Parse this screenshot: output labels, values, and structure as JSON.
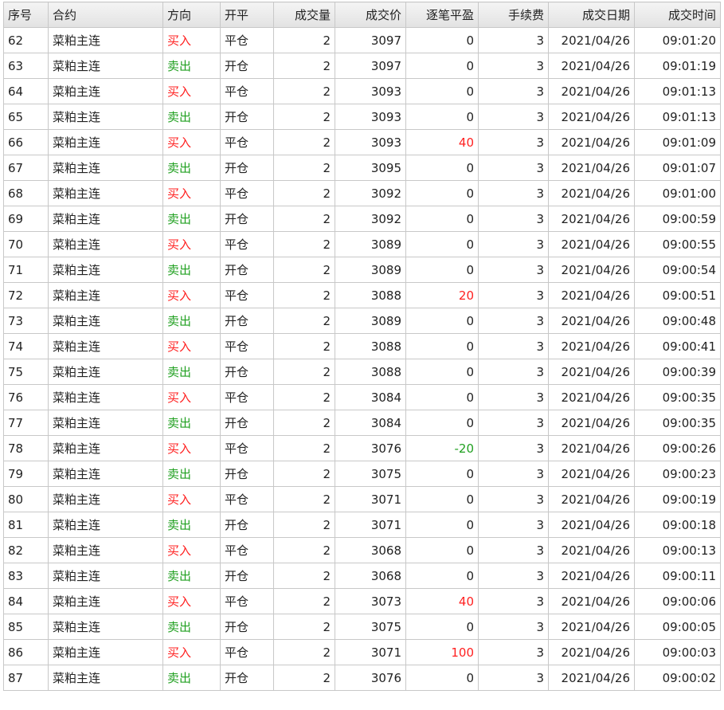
{
  "table": {
    "headers": [
      "序号",
      "合约",
      "方向",
      "开平",
      "成交量",
      "成交价",
      "逐笔平盈",
      "手续费",
      "成交日期",
      "成交时间"
    ],
    "colors": {
      "buy": "#ff2020",
      "sell": "#20a020",
      "profit": "#ff2020",
      "loss": "#20a020"
    },
    "rows": [
      [
        "62",
        "菜粕主连",
        "买入",
        "平仓",
        "2",
        "3097",
        "0",
        "3",
        "2021/04/26",
        "09:01:20"
      ],
      [
        "63",
        "菜粕主连",
        "卖出",
        "开仓",
        "2",
        "3097",
        "0",
        "3",
        "2021/04/26",
        "09:01:19"
      ],
      [
        "64",
        "菜粕主连",
        "买入",
        "平仓",
        "2",
        "3093",
        "0",
        "3",
        "2021/04/26",
        "09:01:13"
      ],
      [
        "65",
        "菜粕主连",
        "卖出",
        "开仓",
        "2",
        "3093",
        "0",
        "3",
        "2021/04/26",
        "09:01:13"
      ],
      [
        "66",
        "菜粕主连",
        "买入",
        "平仓",
        "2",
        "3093",
        "40",
        "3",
        "2021/04/26",
        "09:01:09"
      ],
      [
        "67",
        "菜粕主连",
        "卖出",
        "开仓",
        "2",
        "3095",
        "0",
        "3",
        "2021/04/26",
        "09:01:07"
      ],
      [
        "68",
        "菜粕主连",
        "买入",
        "平仓",
        "2",
        "3092",
        "0",
        "3",
        "2021/04/26",
        "09:01:00"
      ],
      [
        "69",
        "菜粕主连",
        "卖出",
        "开仓",
        "2",
        "3092",
        "0",
        "3",
        "2021/04/26",
        "09:00:59"
      ],
      [
        "70",
        "菜粕主连",
        "买入",
        "平仓",
        "2",
        "3089",
        "0",
        "3",
        "2021/04/26",
        "09:00:55"
      ],
      [
        "71",
        "菜粕主连",
        "卖出",
        "开仓",
        "2",
        "3089",
        "0",
        "3",
        "2021/04/26",
        "09:00:54"
      ],
      [
        "72",
        "菜粕主连",
        "买入",
        "平仓",
        "2",
        "3088",
        "20",
        "3",
        "2021/04/26",
        "09:00:51"
      ],
      [
        "73",
        "菜粕主连",
        "卖出",
        "开仓",
        "2",
        "3089",
        "0",
        "3",
        "2021/04/26",
        "09:00:48"
      ],
      [
        "74",
        "菜粕主连",
        "买入",
        "平仓",
        "2",
        "3088",
        "0",
        "3",
        "2021/04/26",
        "09:00:41"
      ],
      [
        "75",
        "菜粕主连",
        "卖出",
        "开仓",
        "2",
        "3088",
        "0",
        "3",
        "2021/04/26",
        "09:00:39"
      ],
      [
        "76",
        "菜粕主连",
        "买入",
        "平仓",
        "2",
        "3084",
        "0",
        "3",
        "2021/04/26",
        "09:00:35"
      ],
      [
        "77",
        "菜粕主连",
        "卖出",
        "开仓",
        "2",
        "3084",
        "0",
        "3",
        "2021/04/26",
        "09:00:35"
      ],
      [
        "78",
        "菜粕主连",
        "买入",
        "平仓",
        "2",
        "3076",
        "-20",
        "3",
        "2021/04/26",
        "09:00:26"
      ],
      [
        "79",
        "菜粕主连",
        "卖出",
        "开仓",
        "2",
        "3075",
        "0",
        "3",
        "2021/04/26",
        "09:00:23"
      ],
      [
        "80",
        "菜粕主连",
        "买入",
        "平仓",
        "2",
        "3071",
        "0",
        "3",
        "2021/04/26",
        "09:00:19"
      ],
      [
        "81",
        "菜粕主连",
        "卖出",
        "开仓",
        "2",
        "3071",
        "0",
        "3",
        "2021/04/26",
        "09:00:18"
      ],
      [
        "82",
        "菜粕主连",
        "买入",
        "平仓",
        "2",
        "3068",
        "0",
        "3",
        "2021/04/26",
        "09:00:13"
      ],
      [
        "83",
        "菜粕主连",
        "卖出",
        "开仓",
        "2",
        "3068",
        "0",
        "3",
        "2021/04/26",
        "09:00:11"
      ],
      [
        "84",
        "菜粕主连",
        "买入",
        "平仓",
        "2",
        "3073",
        "40",
        "3",
        "2021/04/26",
        "09:00:06"
      ],
      [
        "85",
        "菜粕主连",
        "卖出",
        "开仓",
        "2",
        "3075",
        "0",
        "3",
        "2021/04/26",
        "09:00:05"
      ],
      [
        "86",
        "菜粕主连",
        "买入",
        "平仓",
        "2",
        "3071",
        "100",
        "3",
        "2021/04/26",
        "09:00:03"
      ],
      [
        "87",
        "菜粕主连",
        "卖出",
        "开仓",
        "2",
        "3076",
        "0",
        "3",
        "2021/04/26",
        "09:00:02"
      ]
    ]
  }
}
